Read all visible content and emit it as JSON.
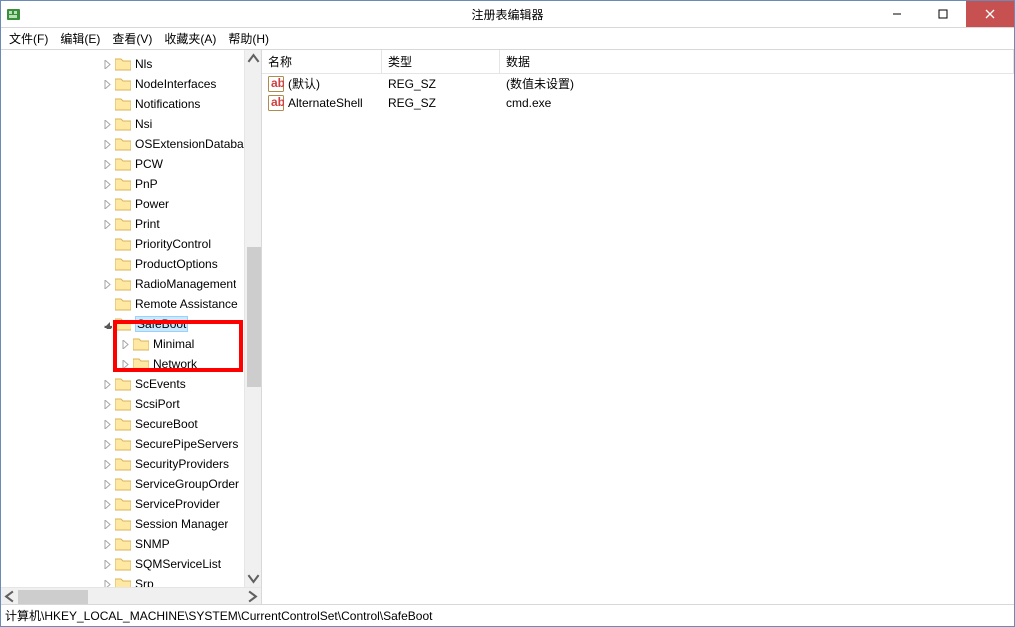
{
  "window": {
    "title": "注册表编辑器"
  },
  "menu": {
    "file": "文件(F)",
    "edit": "编辑(E)",
    "view": "查看(V)",
    "favorites": "收藏夹(A)",
    "help": "帮助(H)"
  },
  "tree": {
    "items": [
      {
        "label": "Nls",
        "indent": 100,
        "expander": "collapsed"
      },
      {
        "label": "NodeInterfaces",
        "indent": 100,
        "expander": "collapsed"
      },
      {
        "label": "Notifications",
        "indent": 100,
        "expander": "none"
      },
      {
        "label": "Nsi",
        "indent": 100,
        "expander": "collapsed"
      },
      {
        "label": "OSExtensionDatabase",
        "indent": 100,
        "expander": "collapsed"
      },
      {
        "label": "PCW",
        "indent": 100,
        "expander": "collapsed"
      },
      {
        "label": "PnP",
        "indent": 100,
        "expander": "collapsed"
      },
      {
        "label": "Power",
        "indent": 100,
        "expander": "collapsed"
      },
      {
        "label": "Print",
        "indent": 100,
        "expander": "collapsed"
      },
      {
        "label": "PriorityControl",
        "indent": 100,
        "expander": "none"
      },
      {
        "label": "ProductOptions",
        "indent": 100,
        "expander": "none"
      },
      {
        "label": "RadioManagement",
        "indent": 100,
        "expander": "collapsed"
      },
      {
        "label": "Remote Assistance",
        "indent": 100,
        "expander": "none"
      },
      {
        "label": "SafeBoot",
        "indent": 100,
        "expander": "expanded",
        "selected": true
      },
      {
        "label": "Minimal",
        "indent": 118,
        "expander": "collapsed"
      },
      {
        "label": "Network",
        "indent": 118,
        "expander": "collapsed"
      },
      {
        "label": "ScEvents",
        "indent": 100,
        "expander": "collapsed"
      },
      {
        "label": "ScsiPort",
        "indent": 100,
        "expander": "collapsed"
      },
      {
        "label": "SecureBoot",
        "indent": 100,
        "expander": "collapsed"
      },
      {
        "label": "SecurePipeServers",
        "indent": 100,
        "expander": "collapsed"
      },
      {
        "label": "SecurityProviders",
        "indent": 100,
        "expander": "collapsed"
      },
      {
        "label": "ServiceGroupOrder",
        "indent": 100,
        "expander": "collapsed"
      },
      {
        "label": "ServiceProvider",
        "indent": 100,
        "expander": "collapsed"
      },
      {
        "label": "Session Manager",
        "indent": 100,
        "expander": "collapsed"
      },
      {
        "label": "SNMP",
        "indent": 100,
        "expander": "collapsed"
      },
      {
        "label": "SQMServiceList",
        "indent": 100,
        "expander": "collapsed"
      },
      {
        "label": "Srp",
        "indent": 100,
        "expander": "collapsed"
      }
    ]
  },
  "list": {
    "headers": {
      "name": "名称",
      "type": "类型",
      "data": "数据"
    },
    "rows": [
      {
        "name": "(默认)",
        "type": "REG_SZ",
        "data": "(数值未设置)"
      },
      {
        "name": "AlternateShell",
        "type": "REG_SZ",
        "data": "cmd.exe"
      }
    ]
  },
  "statusbar": {
    "path": "计算机\\HKEY_LOCAL_MACHINE\\SYSTEM\\CurrentControlSet\\Control\\SafeBoot"
  }
}
